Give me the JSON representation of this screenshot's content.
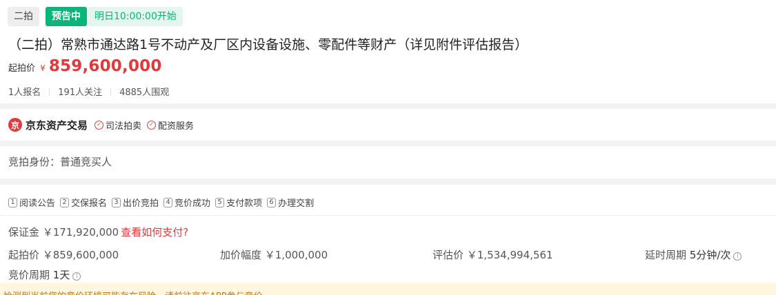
{
  "header": {
    "round_tag": "二拍",
    "status_tag": "预告中",
    "start_time": "明日10:00:00开始",
    "title": "（二拍）常熟市通达路1号不动产及厂区内设备设施、零配件等财产（详见附件评估报告）",
    "price_label": "起拍价",
    "currency": "¥",
    "price": "859,600,000",
    "stats": [
      "1人报名",
      "191人关注",
      "4885人围观"
    ]
  },
  "platform": {
    "logo_icon": "jd-logo-icon",
    "brand": "京东资产交易",
    "services": [
      "司法拍卖",
      "配资服务"
    ]
  },
  "identity": {
    "text": "竞拍身份：普通竞买人"
  },
  "steps": [
    {
      "num": "1",
      "label": "阅读公告"
    },
    {
      "num": "2",
      "label": "交保报名"
    },
    {
      "num": "3",
      "label": "出价竞拍"
    },
    {
      "num": "4",
      "label": "竞价成功"
    },
    {
      "num": "5",
      "label": "支付款项"
    },
    {
      "num": "6",
      "label": "办理交割"
    }
  ],
  "deposit": {
    "label": "保证金 ￥171,920,000",
    "link": "查看如何支付?"
  },
  "info": {
    "start_price": "起拍价 ￥859,600,000",
    "increment": "加价幅度 ￥1,000,000",
    "appraisal": "评估价 ￥1,534,994,561",
    "delay_label": "延时周期",
    "delay_value": "5分钟/次",
    "period_label": "竞价周期",
    "period_value": "1天"
  },
  "warning": {
    "text": "检测到当前您的竞价环境可能存在风险，请前往京东APP参与竞价"
  },
  "colors": {
    "accent_red": "#e4393c",
    "status_green": "#0ab57a",
    "warning_bg": "#fff6e0"
  }
}
